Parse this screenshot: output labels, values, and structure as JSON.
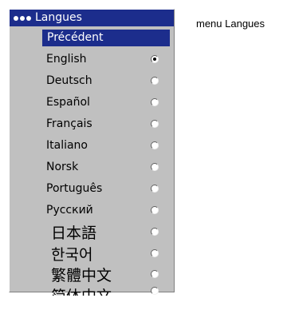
{
  "menu": {
    "title": "Langues",
    "previous": "Précédent",
    "items": [
      {
        "label": "English",
        "selected": true
      },
      {
        "label": "Deutsch",
        "selected": false
      },
      {
        "label": "Español",
        "selected": false
      },
      {
        "label": "Français",
        "selected": false
      },
      {
        "label": "Italiano",
        "selected": false
      },
      {
        "label": "Norsk",
        "selected": false
      },
      {
        "label": "Português",
        "selected": false
      },
      {
        "label": "Русский",
        "selected": false
      },
      {
        "label": "日本語",
        "selected": false
      },
      {
        "label": "한국어",
        "selected": false
      },
      {
        "label": "繁體中文",
        "selected": false
      },
      {
        "label": "简体中文",
        "selected": false
      }
    ]
  },
  "caption": "menu Langues",
  "colors": {
    "highlight": "#1c2d8c",
    "panel": "#c0c0c0"
  }
}
